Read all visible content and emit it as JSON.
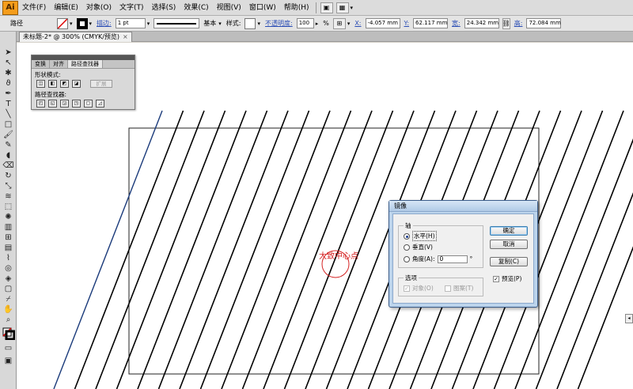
{
  "app": {
    "logo": "Ai"
  },
  "menu": [
    "文件(F)",
    "编辑(E)",
    "对象(O)",
    "文字(T)",
    "选择(S)",
    "效果(C)",
    "视图(V)",
    "窗口(W)",
    "帮助(H)"
  ],
  "control": {
    "object_type": "路径",
    "stroke_link": "描边:",
    "stroke_weight": "1 pt",
    "stroke_profile": "基本",
    "style_label": "样式:",
    "opacity_link": "不透明度:",
    "opacity_value": "100",
    "opacity_unit": "%",
    "x_label": "X:",
    "x_value": "-4.057 mm",
    "y_label": "Y:",
    "y_value": "62.117 mm",
    "w_label": "宽:",
    "w_value": "24.342 mm",
    "h_label": "高:",
    "h_value": "72.084 mm"
  },
  "tab": {
    "title": "未标题-2* @ 300% (CMYK/预览)",
    "close": "×"
  },
  "pathfinder": {
    "tabs": [
      "变换",
      "对齐",
      "路径查找器"
    ],
    "shape_modes_label": "形状模式:",
    "pathfinders_label": "路径查找器:",
    "expand_label": "扩展"
  },
  "canvas": {
    "annotation": "大致中心点",
    "annotation_color": "#d42020",
    "selected_line_color": "#1a3a7a"
  },
  "dialog": {
    "title": "镜像",
    "axis_legend": "轴",
    "horizontal": "水平(H)",
    "vertical": "垂直(V)",
    "angle_label": "角度(A):",
    "angle_value": "0",
    "angle_unit": "°",
    "options_legend": "选项",
    "objects": "对象(O)",
    "patterns": "图案(T)",
    "ok": "确定",
    "cancel": "取消",
    "copy": "复制(C)",
    "preview": "预览(P)",
    "preview_checked": "✓",
    "objects_checked": "✓"
  }
}
